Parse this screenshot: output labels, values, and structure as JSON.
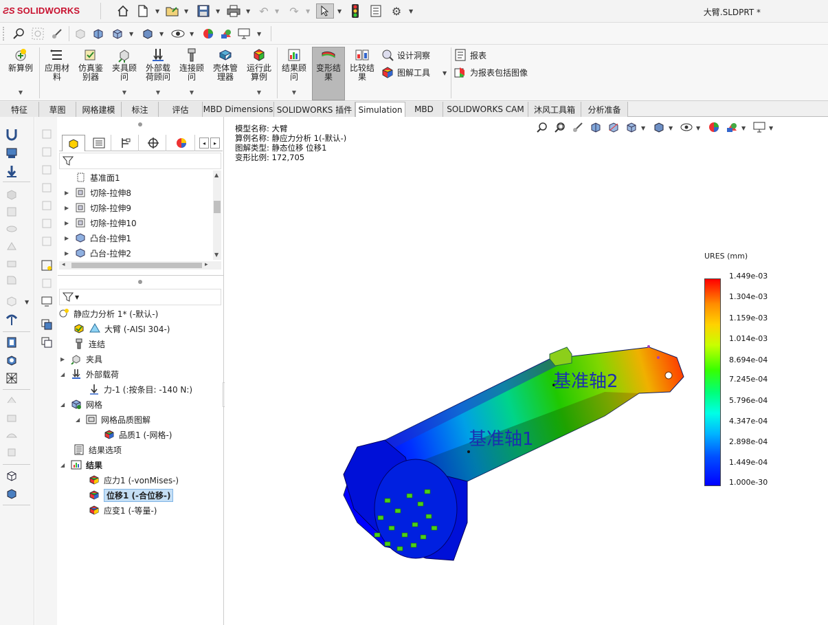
{
  "app": {
    "brand": "SOLIDWORKS",
    "document_title": "大臂.SLDPRT *"
  },
  "ribbon": {
    "buttons": [
      {
        "label": "新算例"
      },
      {
        "label": "应用材料"
      },
      {
        "label": "仿真鉴别器"
      },
      {
        "label": "夹具顾问"
      },
      {
        "label": "外部载荷顾问"
      },
      {
        "label": "连接顾问"
      },
      {
        "label": "壳体管理器"
      },
      {
        "label": "运行此算例"
      },
      {
        "label": "结果顾问"
      },
      {
        "label": "变形结果"
      },
      {
        "label": "比较结果"
      }
    ],
    "small": [
      {
        "label": "设计洞察"
      },
      {
        "label": "图解工具"
      },
      {
        "label": "报表"
      },
      {
        "label": "为报表包括图像"
      }
    ]
  },
  "tabs": [
    "特征",
    "草图",
    "网格建模",
    "标注",
    "评估",
    "MBD Dimensions",
    "SOLIDWORKS 插件",
    "Simulation",
    "MBD",
    "SOLIDWORKS CAM",
    "沐风工具箱",
    "分析准备"
  ],
  "active_tab": "Simulation",
  "feature_tree": {
    "items": [
      {
        "label": "基准面1"
      },
      {
        "label": "切除-拉伸8"
      },
      {
        "label": "切除-拉伸9"
      },
      {
        "label": "切除-拉伸10"
      },
      {
        "label": "凸台-拉伸1"
      },
      {
        "label": "凸台-拉伸2"
      }
    ]
  },
  "sim_tree": {
    "items": [
      {
        "label": "静应力分析 1* (-默认-)"
      },
      {
        "label": "大臂 (-AISI 304-)"
      },
      {
        "label": "连结"
      },
      {
        "label": "夹具"
      },
      {
        "label": "外部载荷"
      },
      {
        "label": "力-1 (:按条目: -140 N:)"
      },
      {
        "label": "网格"
      },
      {
        "label": "网格品质图解"
      },
      {
        "label": "品质1 (-网格-)"
      },
      {
        "label": "结果选项"
      },
      {
        "label": "结果"
      },
      {
        "label": "应力1 (-vonMises-)"
      },
      {
        "label": "位移1 (-合位移-)"
      },
      {
        "label": "应变1 (-等量-)"
      }
    ]
  },
  "plot_info": {
    "model": "模型名称: 大臂",
    "study": "算例名称: 静应力分析 1(-默认-)",
    "plot_type": "图解类型: 静态位移 位移1",
    "scale": "变形比例: 172,705"
  },
  "model_labels": {
    "axis1": "基准轴1",
    "axis2": "基准轴2"
  },
  "legend": {
    "title": "URES (mm)",
    "values": [
      "1.449e-03",
      "1.304e-03",
      "1.159e-03",
      "1.014e-03",
      "8.694e-04",
      "7.245e-04",
      "5.796e-04",
      "4.347e-04",
      "2.898e-04",
      "1.449e-04",
      "1.000e-30"
    ]
  }
}
